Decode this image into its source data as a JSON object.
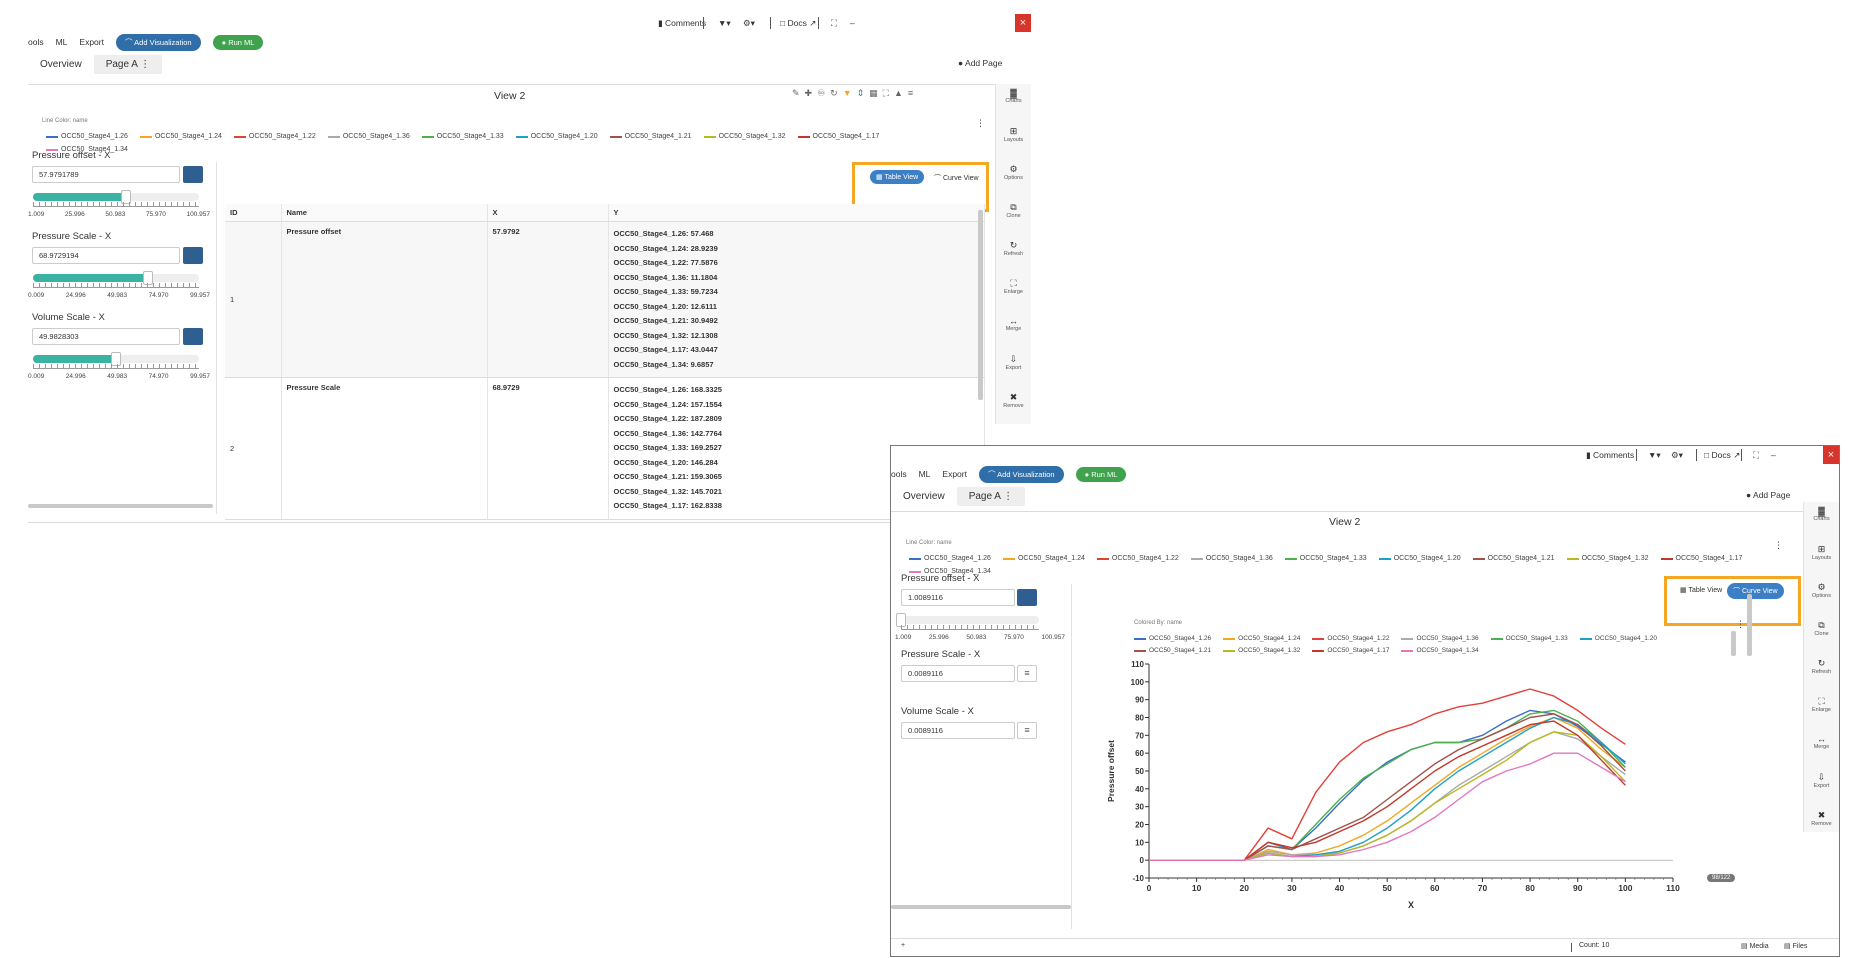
{
  "app": {
    "menu": [
      "ools",
      "ML",
      "Export"
    ],
    "menu_b": [
      "ools",
      "ML",
      "Export"
    ],
    "add_viz": "Add Visualization",
    "run_ml": "Run ML",
    "comments": "Comments",
    "docs": "Docs",
    "close": "×",
    "add_page": "Add Page"
  },
  "tabs": [
    {
      "label": "Overview"
    },
    {
      "label": "Page A"
    }
  ],
  "view_title": "View 2",
  "line_color_label": "Line Color: name",
  "colored_by_label": "Colored By: name",
  "series": [
    {
      "name": "OCC50_Stage4_1.26",
      "color": "#3b6fc4"
    },
    {
      "name": "OCC50_Stage4_1.24",
      "color": "#f5a623"
    },
    {
      "name": "OCC50_Stage4_1.22",
      "color": "#e3403a"
    },
    {
      "name": "OCC50_Stage4_1.36",
      "color": "#aaaaaa"
    },
    {
      "name": "OCC50_Stage4_1.33",
      "color": "#4caf50"
    },
    {
      "name": "OCC50_Stage4_1.20",
      "color": "#1fa0c8"
    },
    {
      "name": "OCC50_Stage4_1.21",
      "color": "#a0524b"
    },
    {
      "name": "OCC50_Stage4_1.32",
      "color": "#b8b820"
    },
    {
      "name": "OCC50_Stage4_1.17",
      "color": "#c0392b"
    },
    {
      "name": "OCC50_Stage4_1.34",
      "color": "#e377c2"
    }
  ],
  "controls_a": [
    {
      "title": "Pressure offset - X",
      "value": "57.9791789",
      "fill": 0.56,
      "ticks": [
        "1.009",
        "25.996",
        "50.983",
        "75.970",
        "100.957"
      ]
    },
    {
      "title": "Pressure Scale - X",
      "value": "68.9729194",
      "fill": 0.69,
      "ticks": [
        "0.009",
        "24.996",
        "49.983",
        "74.970",
        "99.957"
      ]
    },
    {
      "title": "Volume Scale - X",
      "value": "49.9828303",
      "fill": 0.5,
      "ticks": [
        "0.009",
        "24.996",
        "49.983",
        "74.970",
        "99.957"
      ]
    }
  ],
  "controls_b": [
    {
      "title": "Pressure offset - X",
      "value": "1.0089116",
      "fill": 0.0,
      "ticks": [
        "1.009",
        "25.996",
        "50.983",
        "75.970",
        "100.957"
      ]
    },
    {
      "title": "Pressure Scale - X",
      "value": "0.0089116"
    },
    {
      "title": "Volume Scale - X",
      "value": "0.0089116"
    }
  ],
  "view_toggle": {
    "table": "Table View",
    "curve": "Curve View"
  },
  "table": {
    "headers": [
      "ID",
      "Name",
      "X",
      "Y"
    ],
    "rows": [
      {
        "id": "1",
        "name": "Pressure offset",
        "x": "57.9792",
        "y": [
          "OCC50_Stage4_1.26: 57.468",
          "OCC50_Stage4_1.24: 28.9239",
          "OCC50_Stage4_1.22: 77.5876",
          "OCC50_Stage4_1.36: 11.1804",
          "OCC50_Stage4_1.33: 59.7234",
          "OCC50_Stage4_1.20: 12.6111",
          "OCC50_Stage4_1.21: 30.9492",
          "OCC50_Stage4_1.32: 12.1308",
          "OCC50_Stage4_1.17: 43.0447",
          "OCC50_Stage4_1.34: 9.6857"
        ]
      },
      {
        "id": "2",
        "name": "Pressure Scale",
        "x": "68.9729",
        "y": [
          "OCC50_Stage4_1.26: 168.3325",
          "OCC50_Stage4_1.24: 157.1554",
          "OCC50_Stage4_1.22: 187.2809",
          "OCC50_Stage4_1.36: 142.7764",
          "OCC50_Stage4_1.33: 169.2527",
          "OCC50_Stage4_1.20: 146.284",
          "OCC50_Stage4_1.21: 159.3065",
          "OCC50_Stage4_1.32: 145.7021",
          "OCC50_Stage4_1.17: 162.8338"
        ]
      }
    ]
  },
  "rail": [
    "Charts",
    "Layouts",
    "Options",
    "Clone",
    "Refresh",
    "Enlarge",
    "Merge",
    "Export",
    "Remove"
  ],
  "status": {
    "count": "Count: 10",
    "media": "Media",
    "files": "Files"
  },
  "pager": "98/122",
  "chart_data": {
    "type": "line",
    "xlabel": "X",
    "ylabel": "Pressure offset",
    "xlim": [
      0,
      110
    ],
    "ylim": [
      -10,
      110
    ],
    "xticks": [
      0,
      10,
      20,
      30,
      40,
      50,
      60,
      70,
      80,
      90,
      100,
      110
    ],
    "yticks": [
      -10,
      0,
      10,
      20,
      30,
      40,
      50,
      60,
      70,
      80,
      90,
      100,
      110
    ],
    "x": [
      0,
      10,
      20,
      25,
      30,
      35,
      40,
      45,
      50,
      55,
      60,
      65,
      70,
      75,
      80,
      85,
      90,
      95,
      100
    ],
    "series": [
      {
        "name": "OCC50_Stage4_1.26",
        "values": [
          0,
          0,
          0,
          10,
          6,
          18,
          32,
          45,
          55,
          62,
          66,
          66,
          70,
          78,
          84,
          82,
          75,
          65,
          55
        ]
      },
      {
        "name": "OCC50_Stage4_1.24",
        "values": [
          0,
          0,
          0,
          6,
          3,
          4,
          8,
          14,
          22,
          32,
          42,
          52,
          60,
          68,
          75,
          80,
          74,
          62,
          52
        ]
      },
      {
        "name": "OCC50_Stage4_1.22",
        "values": [
          0,
          0,
          0,
          18,
          12,
          38,
          55,
          66,
          72,
          76,
          82,
          86,
          88,
          92,
          96,
          92,
          84,
          74,
          65
        ]
      },
      {
        "name": "OCC50_Stage4_1.36",
        "values": [
          0,
          0,
          0,
          5,
          3,
          3,
          4,
          8,
          14,
          22,
          32,
          42,
          50,
          58,
          66,
          72,
          68,
          58,
          48
        ]
      },
      {
        "name": "OCC50_Stage4_1.33",
        "values": [
          0,
          0,
          0,
          8,
          6,
          20,
          34,
          46,
          54,
          62,
          66,
          66,
          68,
          74,
          82,
          84,
          78,
          66,
          52
        ]
      },
      {
        "name": "OCC50_Stage4_1.20",
        "values": [
          0,
          0,
          0,
          4,
          2,
          3,
          5,
          10,
          18,
          28,
          40,
          50,
          58,
          66,
          74,
          80,
          76,
          66,
          54
        ]
      },
      {
        "name": "OCC50_Stage4_1.21",
        "values": [
          0,
          0,
          0,
          8,
          6,
          12,
          18,
          24,
          34,
          44,
          54,
          62,
          68,
          74,
          80,
          82,
          76,
          64,
          50
        ]
      },
      {
        "name": "OCC50_Stage4_1.32",
        "values": [
          0,
          0,
          0,
          4,
          2,
          2,
          4,
          8,
          14,
          22,
          32,
          40,
          48,
          56,
          66,
          72,
          70,
          58,
          44
        ]
      },
      {
        "name": "OCC50_Stage4_1.17",
        "values": [
          0,
          0,
          0,
          10,
          7,
          10,
          16,
          22,
          30,
          40,
          50,
          58,
          64,
          70,
          76,
          78,
          70,
          56,
          42
        ]
      },
      {
        "name": "OCC50_Stage4_1.34",
        "values": [
          0,
          0,
          0,
          3,
          2,
          2,
          3,
          6,
          10,
          16,
          24,
          34,
          44,
          50,
          54,
          60,
          60,
          52,
          44
        ]
      }
    ]
  }
}
